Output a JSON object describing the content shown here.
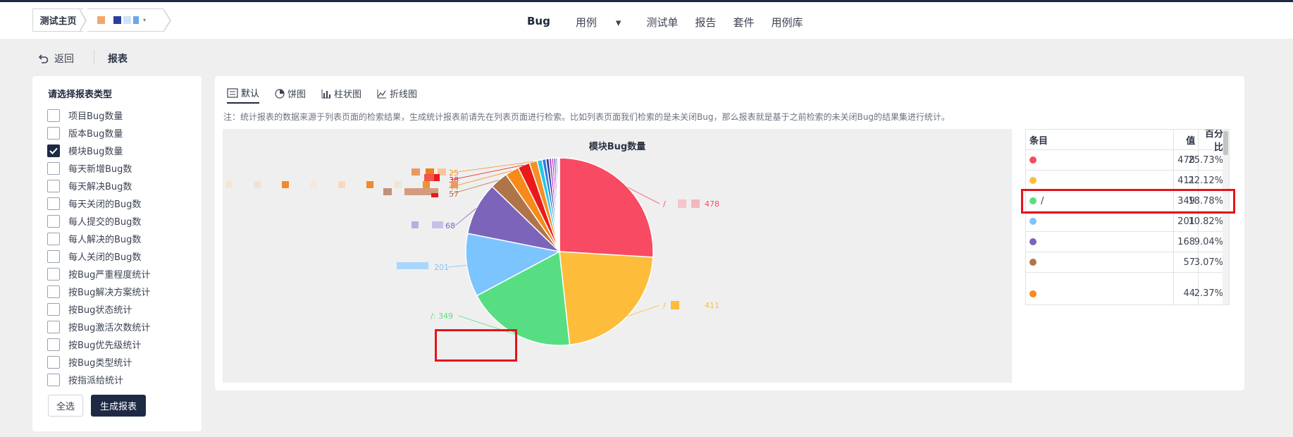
{
  "topbar": {
    "home_crumb": "测试主页",
    "nav": [
      "Bug",
      "用例",
      "测试单",
      "报告",
      "套件",
      "用例库"
    ],
    "active_nav": "Bug"
  },
  "subbar": {
    "back_label": "返回",
    "crumb": "报表"
  },
  "left": {
    "title": "请选择报表类型",
    "options": [
      {
        "label": "项目Bug数量",
        "checked": false
      },
      {
        "label": "版本Bug数量",
        "checked": false
      },
      {
        "label": "模块Bug数量",
        "checked": true
      },
      {
        "label": "每天新增Bug数",
        "checked": false
      },
      {
        "label": "每天解决Bug数",
        "checked": false
      },
      {
        "label": "每天关闭的Bug数",
        "checked": false
      },
      {
        "label": "每人提交的Bug数",
        "checked": false
      },
      {
        "label": "每人解决的Bug数",
        "checked": false
      },
      {
        "label": "每人关闭的Bug数",
        "checked": false
      },
      {
        "label": "按Bug严重程度统计",
        "checked": false
      },
      {
        "label": "按Bug解决方案统计",
        "checked": false
      },
      {
        "label": "按Bug状态统计",
        "checked": false
      },
      {
        "label": "按Bug激活次数统计",
        "checked": false
      },
      {
        "label": "按Bug优先级统计",
        "checked": false
      },
      {
        "label": "按Bug类型统计",
        "checked": false
      },
      {
        "label": "按指派给统计",
        "checked": false
      }
    ],
    "select_all": "全选",
    "generate": "生成报表"
  },
  "tabs": [
    "默认",
    "饼图",
    "柱状图",
    "折线图"
  ],
  "note": "注：统计报表的数据来源于列表页面的检索结果，生成统计报表前请先在列表页面进行检索。比如列表页面我们检索的是未关闭Bug，那么报表就是基于之前检索的未关闭Bug的结果集进行统计。",
  "chart_data": {
    "type": "pie",
    "title": "模块Bug数量",
    "slices": [
      {
        "label": "/",
        "value": 478,
        "color": "#f84a62"
      },
      {
        "label": "/",
        "value": 411,
        "color": "#fdbc3a"
      },
      {
        "label": "/",
        "value": 349,
        "color": "#57de83"
      },
      {
        "label": "",
        "value": 201,
        "color": "#7cc4fd"
      },
      {
        "label": "",
        "value": 168,
        "color": "#7c64bb"
      },
      {
        "label": "",
        "value": 57,
        "color": "#b0744a"
      },
      {
        "label": "",
        "value": 44,
        "color": "#f78a1a"
      },
      {
        "label": "",
        "value": 38,
        "color": "#ea1a1a"
      },
      {
        "label": "",
        "value": 25,
        "color": "#f39124"
      },
      {
        "label": "",
        "value": 16,
        "color": "#22c7ea"
      },
      {
        "label": "",
        "value": 12,
        "color": "#3377d8"
      },
      {
        "label": "",
        "value": 10,
        "color": "#2b3f9a"
      },
      {
        "label": "",
        "value": 8,
        "color": "#9b3ec8"
      },
      {
        "label": "",
        "value": 7,
        "color": "#d43cb5"
      },
      {
        "label": "",
        "value": 6,
        "color": "#5a2fb0"
      },
      {
        "label": "",
        "value": 5,
        "color": "#3b44c4"
      },
      {
        "label": "",
        "value": 4,
        "color": "#c43b8a"
      },
      {
        "label": "",
        "value": 3,
        "color": "#8a3bc4"
      }
    ],
    "value_labels": [
      "478",
      "411",
      "349",
      "201",
      "68",
      "57",
      "44",
      "38",
      "25"
    ],
    "highlight_label": "/: 349"
  },
  "table": {
    "headers": [
      "条目",
      "值",
      "百分比"
    ],
    "rows": [
      {
        "item": "",
        "value": "478",
        "percent": "25.73%",
        "color": "#f84a62"
      },
      {
        "item": "",
        "value": "411",
        "percent": "22.12%",
        "color": "#fdbc3a"
      },
      {
        "item": "/",
        "value": "349",
        "percent": "18.78%",
        "color": "#57de83"
      },
      {
        "item": "",
        "value": "201",
        "percent": "10.82%",
        "color": "#7cc4fd"
      },
      {
        "item": "",
        "value": "168",
        "percent": "9.04%",
        "color": "#7c64bb"
      },
      {
        "item": "",
        "value": "57",
        "percent": "3.07%",
        "color": "#b0744a"
      },
      {
        "item": "",
        "value": "44",
        "percent": "2.37%",
        "color": "#f78a1a"
      }
    ]
  }
}
